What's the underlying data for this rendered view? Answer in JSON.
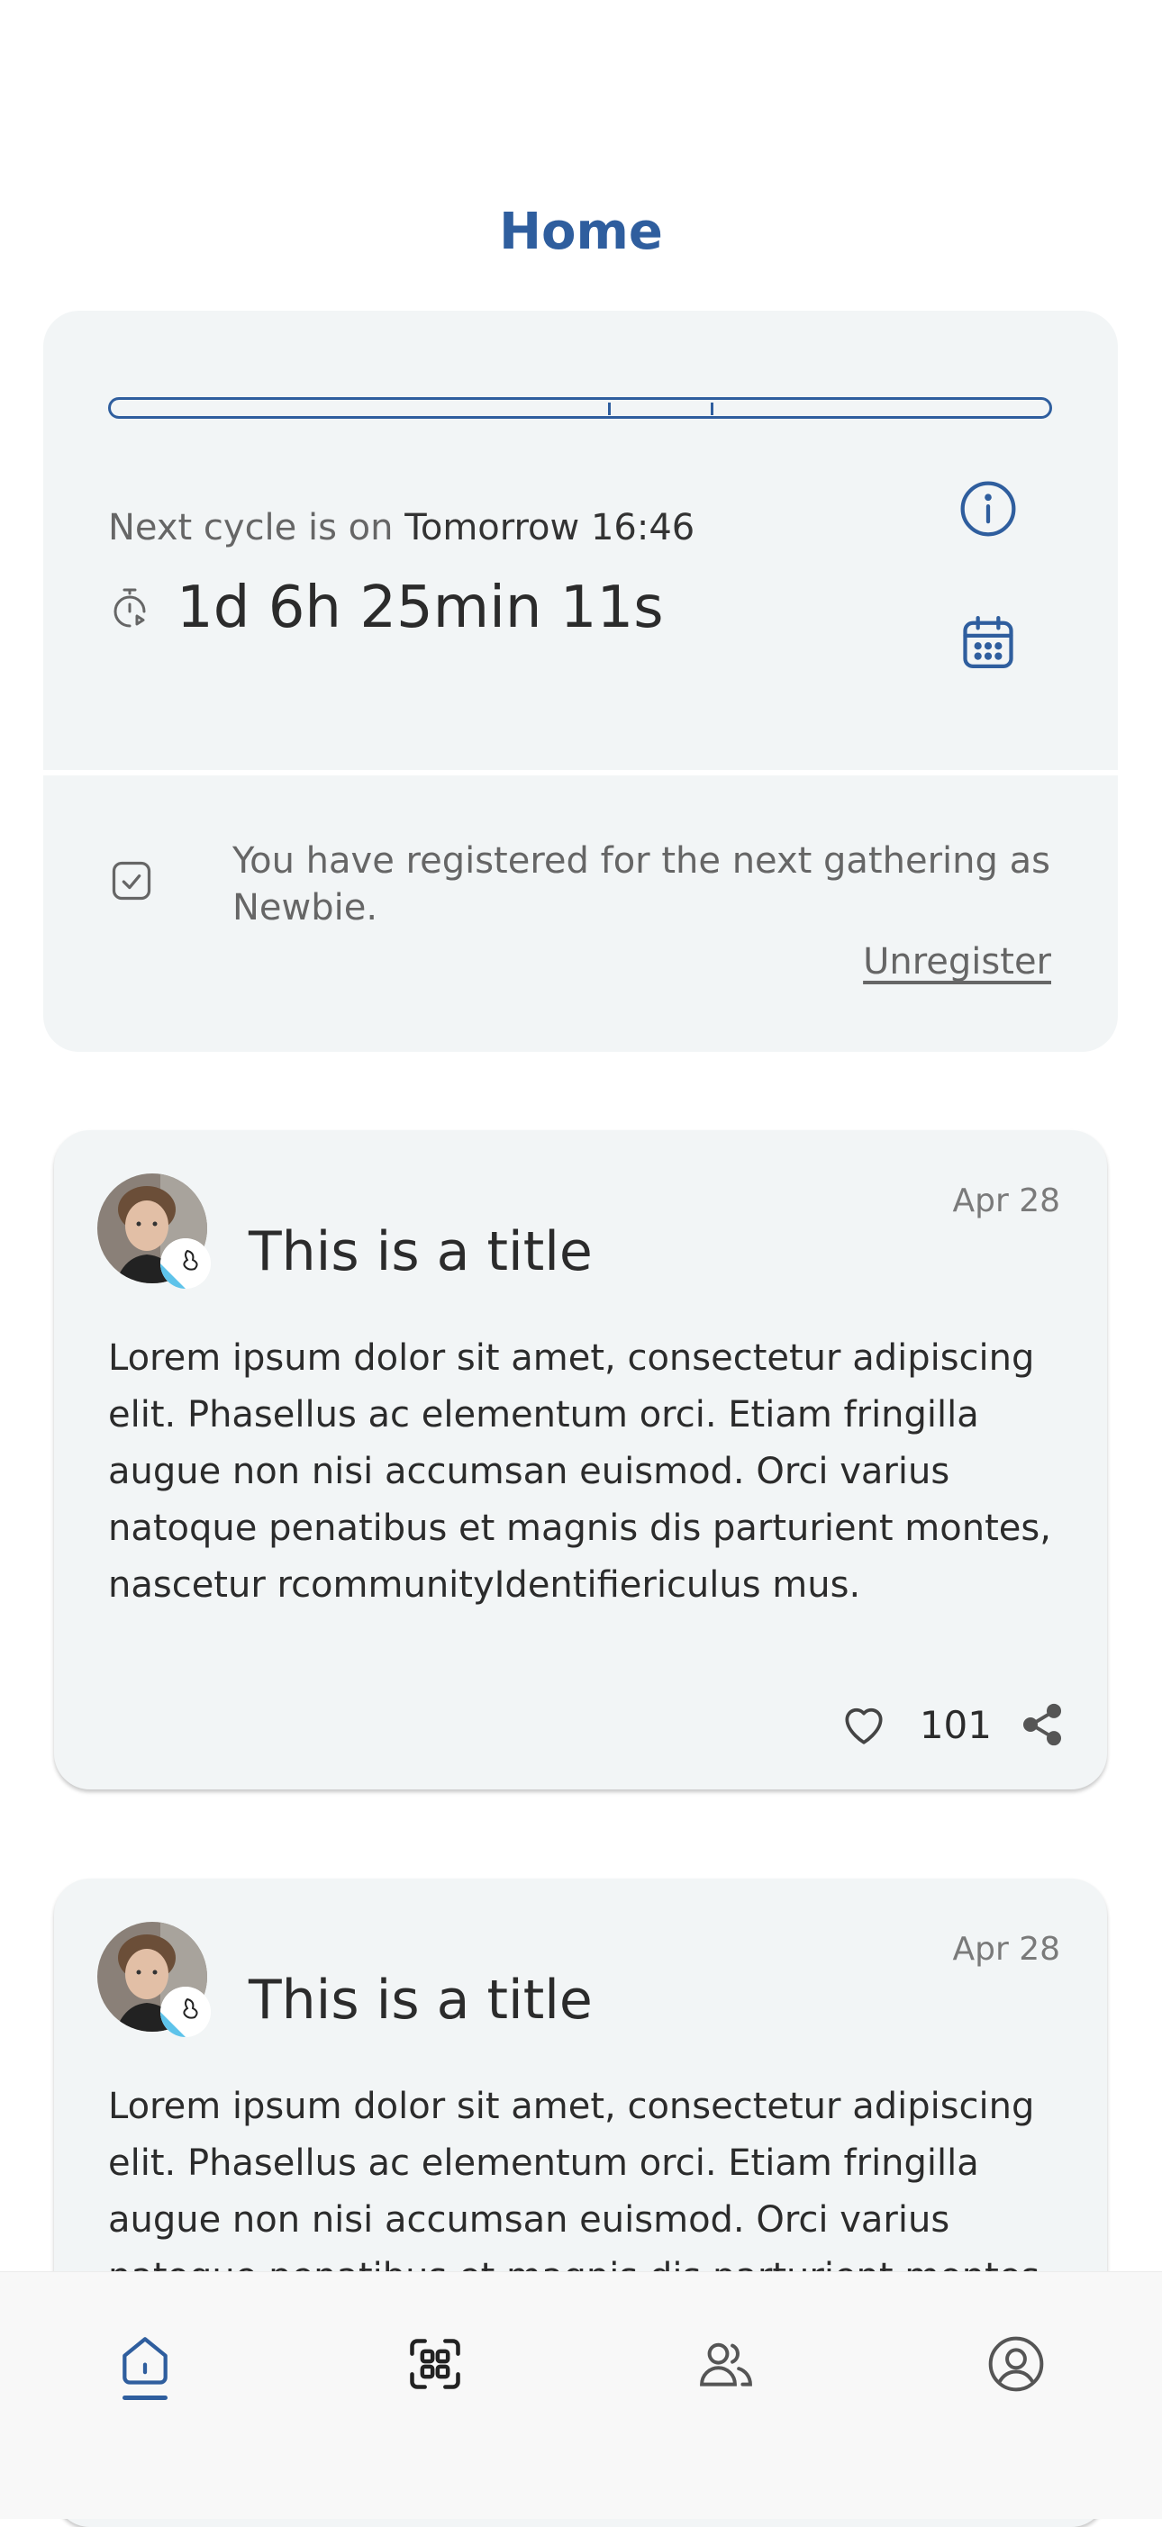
{
  "header": {
    "title": "Home"
  },
  "cycle": {
    "next_label": "Next cycle is on",
    "next_value": "Tomorrow 16:46",
    "countdown": "1d 6h 25min 11s",
    "registration_text": "You have registered for the next gathering as Newbie.",
    "unregister_label": "Unregister"
  },
  "posts": [
    {
      "date": "Apr 28",
      "title": "This is a title",
      "body": "Lorem ipsum dolor sit amet, consectetur adipiscing elit. Phasellus ac elementum orci. Etiam fringilla augue non nisi accumsan euismod. Orci varius natoque penatibus et magnis dis parturient montes, nascetur rcommunityIdentifiericulus mus.",
      "likes": "101"
    },
    {
      "date": "Apr 28",
      "title": "This is a title",
      "body": "Lorem ipsum dolor sit amet, consectetur adipiscing elit. Phasellus ac elementum orci. Etiam fringilla augue non nisi accumsan euismod. Orci varius natoque penatibus et magnis dis parturient montes, nascetur rcommunityIdentifiericulus mus."
    }
  ],
  "nav": {
    "items": [
      {
        "icon": "home-icon",
        "active": true
      },
      {
        "icon": "qr-scan-icon",
        "active": false
      },
      {
        "icon": "people-icon",
        "active": false
      },
      {
        "icon": "profile-icon",
        "active": false
      }
    ]
  },
  "colors": {
    "accent": "#2f5e9e",
    "card_bg": "#f2f5f6",
    "nav_bg": "#f8f8f8"
  }
}
